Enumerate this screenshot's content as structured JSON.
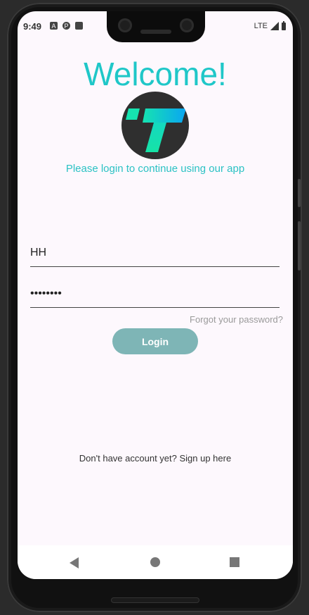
{
  "status_bar": {
    "time": "9:49",
    "icons": [
      "a-icon",
      "p-icon",
      "sd-card-icon"
    ],
    "network": "LTE"
  },
  "login": {
    "title": "Welcome!",
    "subtitle": "Please login to continue using our app",
    "username_value": "HH",
    "password_value": "••••••••",
    "forgot_label": "Forgot your password?",
    "login_label": "Login",
    "signup_label": "Don't have account yet? Sign up here"
  },
  "colors": {
    "accent": "#1fc7c8",
    "button": "#7eb5b6",
    "background": "#fdf8fd"
  }
}
